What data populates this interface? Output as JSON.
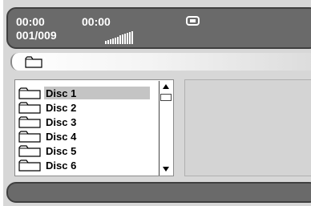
{
  "status": {
    "elapsed": "00:00",
    "total": "00:00",
    "track": "001/009",
    "volume_level": 12,
    "volume_max": 12,
    "mode_icon": "repeat-mode-icon"
  },
  "path": {
    "separator": "\\",
    "folder_icon": "folder-icon"
  },
  "file_list": {
    "items": [
      {
        "label": "Disc 1",
        "selected": true
      },
      {
        "label": "Disc 2",
        "selected": false
      },
      {
        "label": "Disc 3",
        "selected": false
      },
      {
        "label": "Disc 4",
        "selected": false
      },
      {
        "label": "Disc 5",
        "selected": false
      },
      {
        "label": "Disc 6",
        "selected": false
      }
    ]
  },
  "colors": {
    "bar_fill": "#6a6a6a",
    "highlight": "#c4c4c4",
    "panel_bg": "#d4d4d4"
  }
}
